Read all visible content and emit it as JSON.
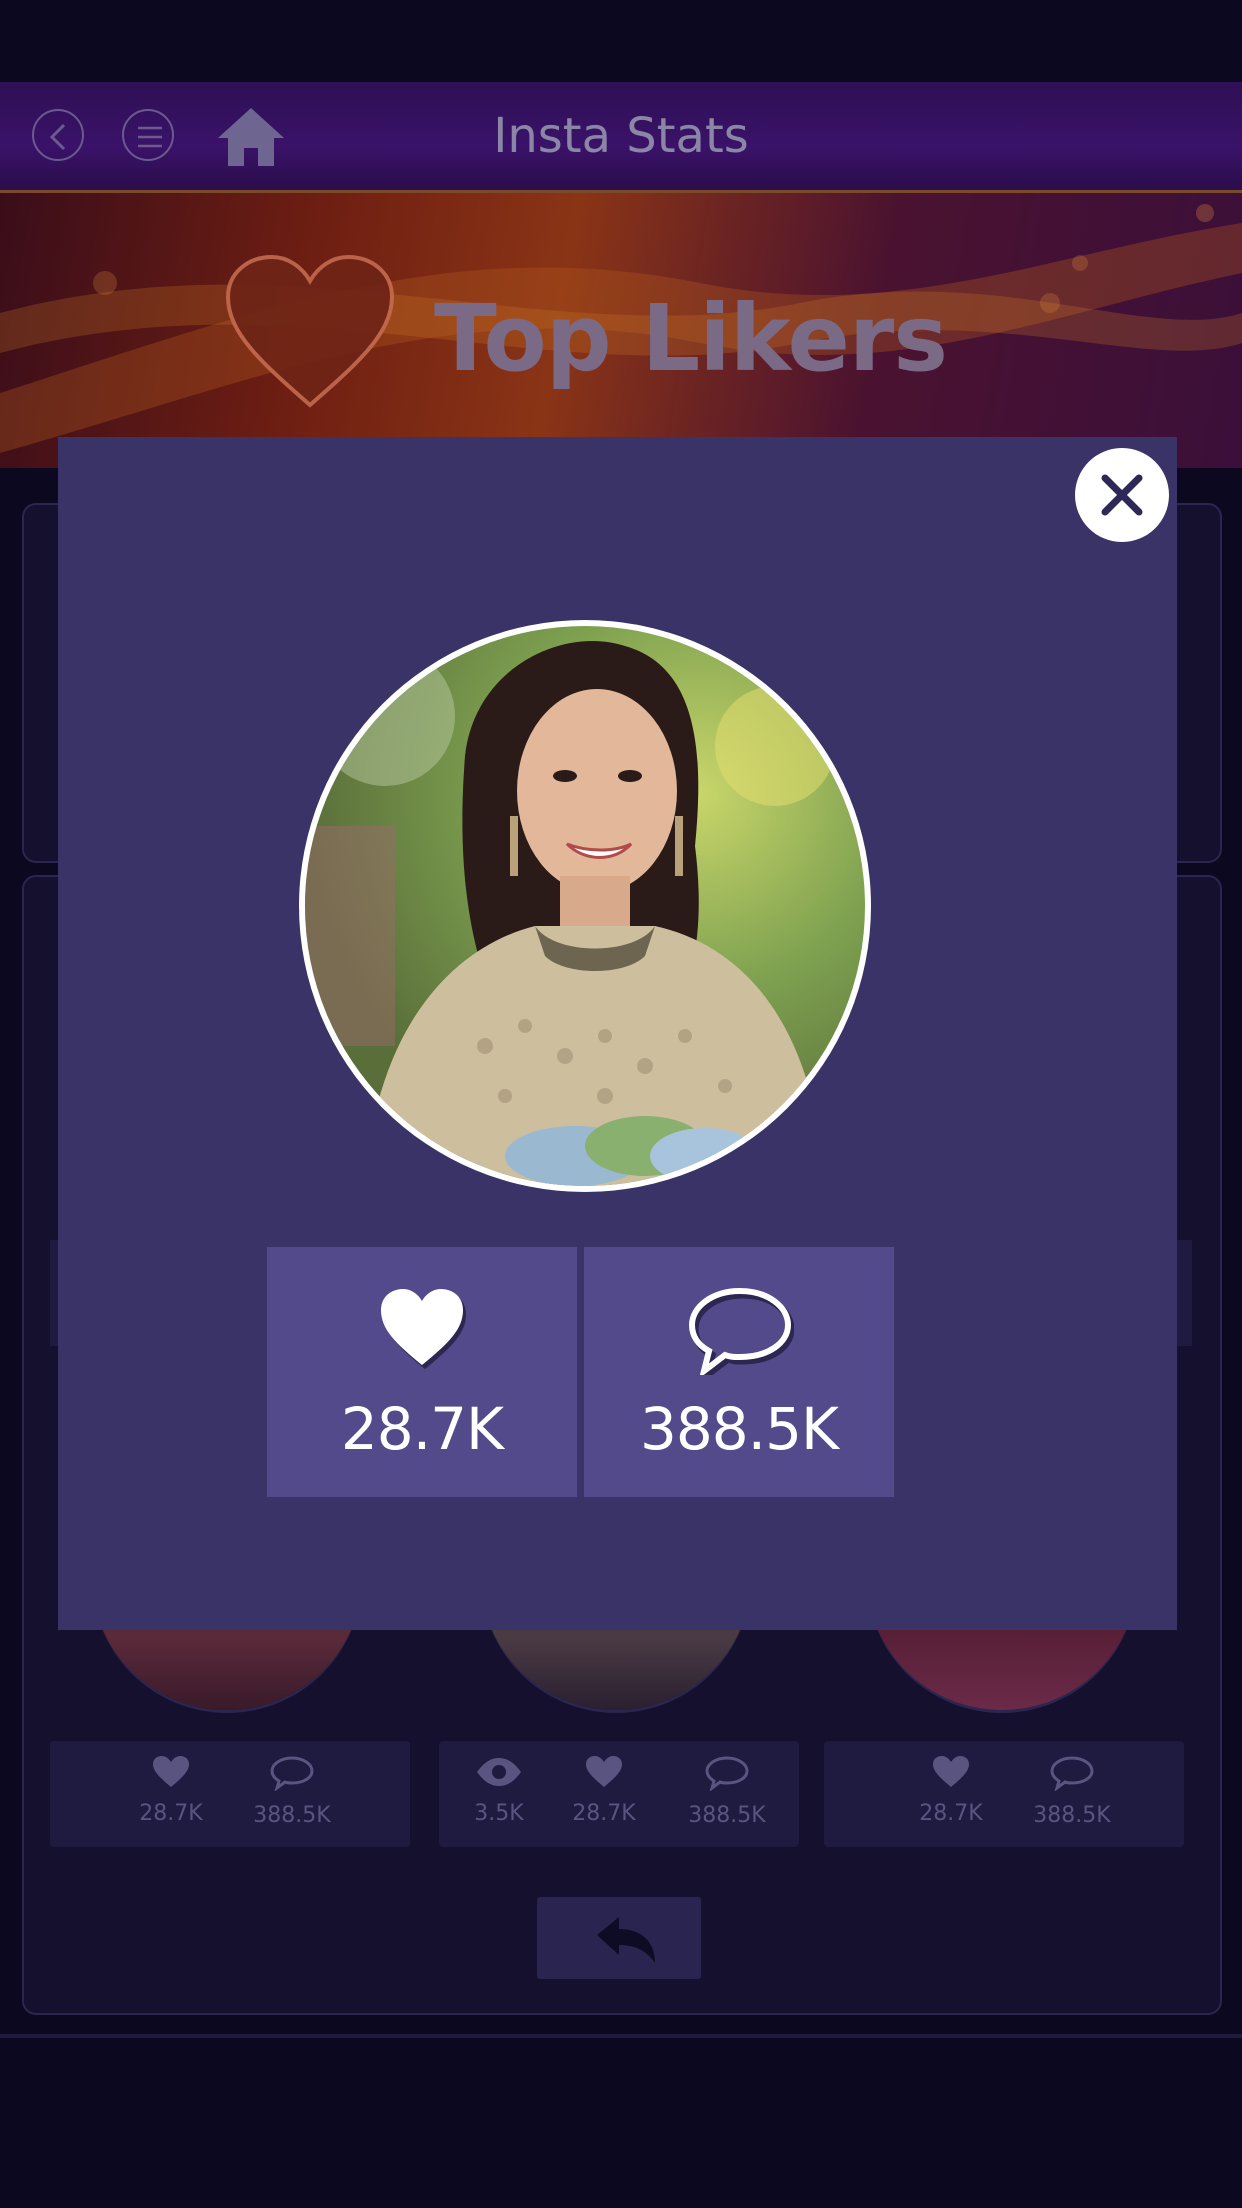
{
  "header": {
    "title": "Insta Stats",
    "back_icon": "chevron-left-icon",
    "menu_icon": "hamburger-menu-icon",
    "home_icon": "home-icon"
  },
  "banner": {
    "title": "Top Likers",
    "icon": "heart-icon"
  },
  "modal": {
    "close_icon": "close-icon",
    "profile_image": "profile-photo",
    "likes": {
      "icon": "heart-icon",
      "value": "28.7K"
    },
    "comments": {
      "icon": "speech-bubble-icon",
      "value": "388.5K"
    }
  },
  "background_cards": [
    {
      "stats": [
        {
          "icon": "heart-icon",
          "value": "28.7K"
        },
        {
          "icon": "speech-bubble-icon",
          "value": "388.5K"
        }
      ]
    },
    {
      "stats": [
        {
          "icon": "eye-icon",
          "value": "3.5K"
        },
        {
          "icon": "heart-icon",
          "value": "28.7K"
        },
        {
          "icon": "speech-bubble-icon",
          "value": "388.5K"
        }
      ]
    },
    {
      "stats": [
        {
          "icon": "heart-icon",
          "value": "28.7K"
        },
        {
          "icon": "speech-bubble-icon",
          "value": "388.5K"
        }
      ]
    }
  ],
  "back_button_icon": "undo-arrow-icon",
  "colors": {
    "modal_bg": "#3a3367",
    "stat_card_bg": "#524a8a",
    "page_bg": "#0b0820"
  }
}
